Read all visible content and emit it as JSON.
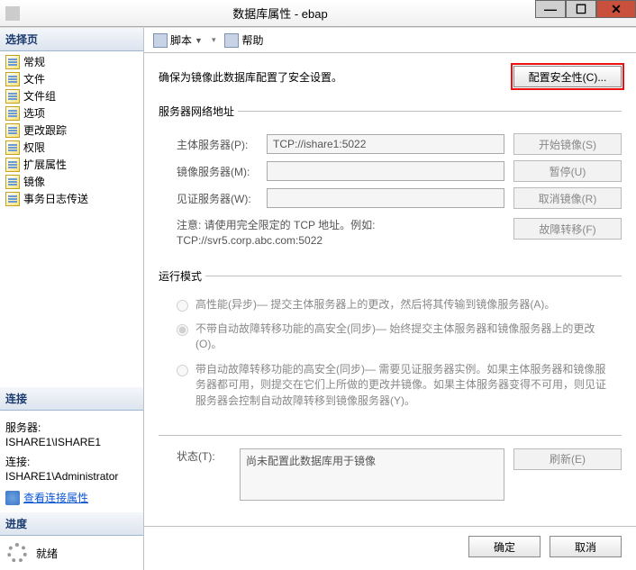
{
  "window": {
    "title": "数据库属性 - ebap"
  },
  "left": {
    "select_page": "选择页",
    "pages": [
      "常规",
      "文件",
      "文件组",
      "选项",
      "更改跟踪",
      "权限",
      "扩展属性",
      "镜像",
      "事务日志传送"
    ],
    "connection_header": "连接",
    "server_label": "服务器:",
    "server_value": "ISHARE1\\ISHARE1",
    "conn_label": "连接:",
    "conn_value": "ISHARE1\\Administrator",
    "view_props": "查看连接属性",
    "progress_header": "进度",
    "status": "就绪"
  },
  "toolbar": {
    "script": "脚本",
    "help": "帮助"
  },
  "content": {
    "security_prompt": "确保为镜像此数据库配置了安全设置。",
    "config_security_btn": "配置安全性(C)...",
    "net_addr_legend": "服务器网络地址",
    "principal_label": "主体服务器(P):",
    "principal_value": "TCP://ishare1:5022",
    "mirror_label": "镜像服务器(M):",
    "mirror_value": "",
    "witness_label": "见证服务器(W):",
    "witness_value": "",
    "start_btn": "开始镜像(S)",
    "pause_btn": "暂停(U)",
    "remove_btn": "取消镜像(R)",
    "note_text": "注意: 请使用完全限定的 TCP 地址。例如:\nTCP://svr5.corp.abc.com:5022",
    "failover_btn": "故障转移(F)",
    "mode_legend": "运行模式",
    "mode_hp": "高性能(异步)— 提交主体服务器上的更改，然后将其传输到镜像服务器(A)。",
    "mode_hs_nofo": "不带自动故障转移功能的高安全(同步)— 始终提交主体服务器和镜像服务器上的更改(O)。",
    "mode_hs_fo": "带自动故障转移功能的高安全(同步)— 需要见证服务器实例。如果主体服务器和镜像服务器都可用，则提交在它们上所做的更改并镜像。如果主体服务器变得不可用，则见证服务器会控制自动故障转移到镜像服务器(Y)。",
    "status_label": "状态(T):",
    "status_value": "尚未配置此数据库用于镜像",
    "refresh_btn": "刷新(E)"
  },
  "footer": {
    "ok": "确定",
    "cancel": "取消"
  }
}
